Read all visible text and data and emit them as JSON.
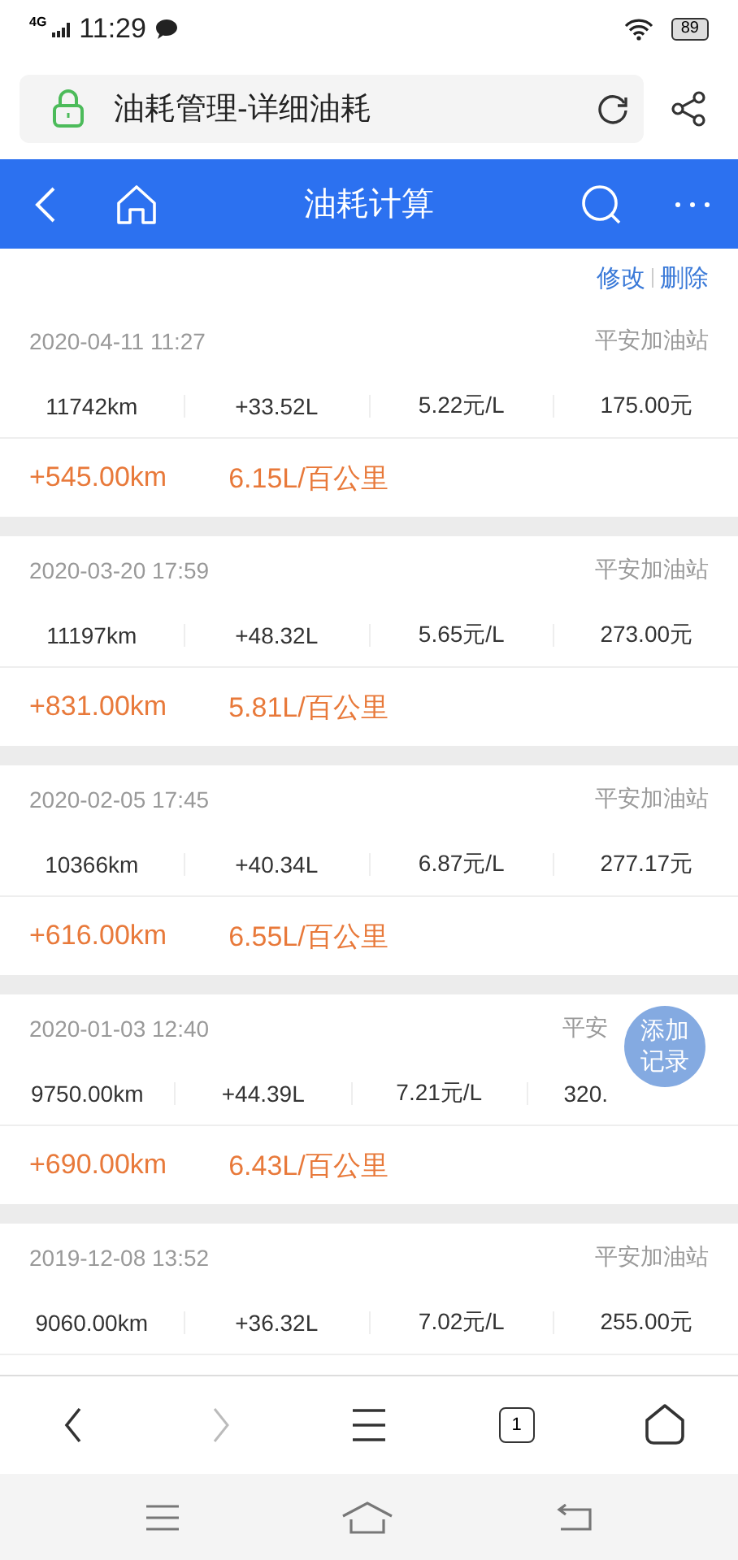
{
  "status_bar": {
    "network": "4G",
    "time": "11:29",
    "battery": "89"
  },
  "address_bar": {
    "title": "油耗管理-详细油耗"
  },
  "header": {
    "title": "油耗计算"
  },
  "actions": [
    "修改",
    "删除"
  ],
  "records": [
    {
      "date": "2020-04-11 11:27",
      "station": "平安加油站",
      "odometer": "11742km",
      "fuel": "+33.52L",
      "unit_price": "5.22元/L",
      "amount": "175.00元",
      "distance": "+545.00km",
      "consumption": "6.15L/百公里"
    },
    {
      "date": "2020-03-20 17:59",
      "station": "平安加油站",
      "odometer": "11197km",
      "fuel": "+48.32L",
      "unit_price": "5.65元/L",
      "amount": "273.00元",
      "distance": "+831.00km",
      "consumption": "5.81L/百公里"
    },
    {
      "date": "2020-02-05 17:45",
      "station": "平安加油站",
      "odometer": "10366km",
      "fuel": "+40.34L",
      "unit_price": "6.87元/L",
      "amount": "277.17元",
      "distance": "+616.00km",
      "consumption": "6.55L/百公里"
    },
    {
      "date": "2020-01-03 12:40",
      "station": "平安",
      "odometer": "9750.00km",
      "fuel": "+44.39L",
      "unit_price": "7.21元/L",
      "amount": "320.",
      "distance": "+690.00km",
      "consumption": "6.43L/百公里",
      "under_button": true
    },
    {
      "date": "2019-12-08 13:52",
      "station": "平安加油站",
      "odometer": "9060.00km",
      "fuel": "+36.32L",
      "unit_price": "7.02元/L",
      "amount": "255.00元"
    }
  ],
  "fab": {
    "label": "添加记录"
  },
  "browser_nav": {
    "tab_count": "1",
    "forward_disabled": true
  }
}
